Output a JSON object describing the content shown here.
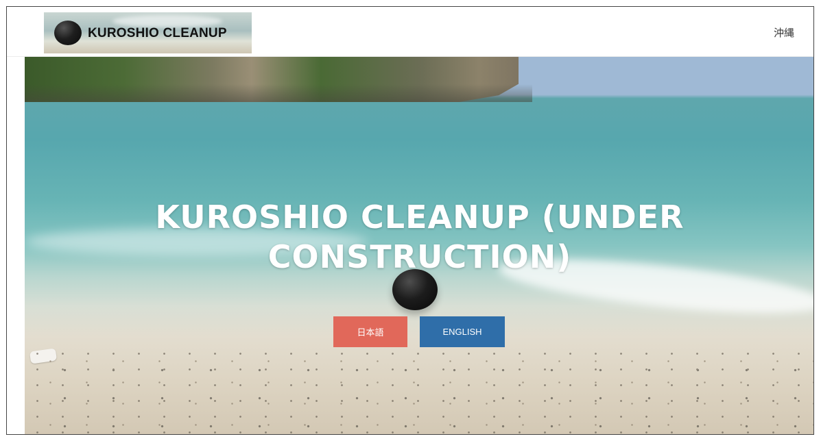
{
  "navbar": {
    "logo_text": "KUROSHIO CLEANUP",
    "link_okinawa": "沖縄"
  },
  "hero": {
    "title": "KUROSHIO CLEANUP (UNDER CONSTRUCTION)",
    "buttons": {
      "japanese": "日本語",
      "english": "ENGLISH"
    }
  },
  "colors": {
    "japanese_button": "#e1685a",
    "english_button": "#2f6ea9"
  }
}
